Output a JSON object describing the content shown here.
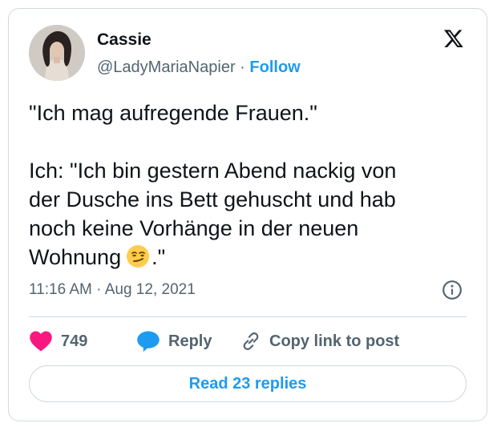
{
  "author": {
    "name": "Cassie",
    "handle": "@LadyMariaNapier",
    "separator": "·",
    "follow_label": "Follow"
  },
  "tweet": {
    "lines_paragraph1": [
      "\"Ich mag aufregende Frauen.\""
    ],
    "lines_paragraph2": [
      "Ich: \"Ich bin gestern Abend nackig von",
      "der Dusche ins Bett gehuscht und hab",
      "noch keine Vorhänge in der neuen"
    ],
    "last_line_before_emoji": "Wohnung",
    "emoji": "smirking-face-emoji",
    "last_line_after_emoji": ".\""
  },
  "meta": {
    "time": "11:16 AM",
    "separator": "·",
    "date": "Aug 12, 2021"
  },
  "actions": {
    "like_count": "749",
    "reply_label": "Reply",
    "copy_label": "Copy link to post"
  },
  "replies_button": "Read 23 replies",
  "colors": {
    "accent": "#1d9bf0",
    "like": "#f91880",
    "muted": "#536471",
    "border": "#cfd9de"
  }
}
